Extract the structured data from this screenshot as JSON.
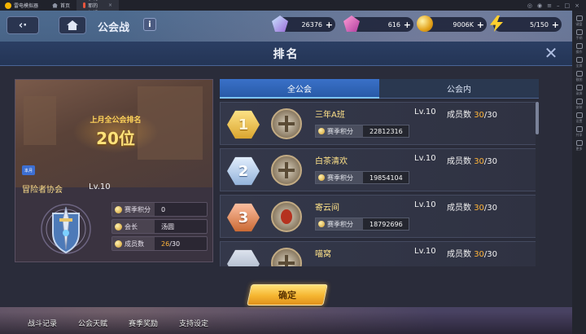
{
  "emulator": {
    "app_name": "雷电模拟器",
    "tabs": [
      {
        "label": "首页"
      },
      {
        "label": "伊利耶的幻想"
      }
    ],
    "side_tools": [
      "键盘",
      "手柄",
      "操作",
      "全屏",
      "截图",
      "录屏",
      "安装",
      "设置",
      "共享",
      "更多"
    ]
  },
  "hud": {
    "title": "公会战",
    "info_label": "i",
    "resources": [
      {
        "icon": "gem-icon",
        "value": "26376"
      },
      {
        "icon": "pink-gem-icon",
        "value": "616"
      },
      {
        "icon": "coin-icon",
        "value": "9006K"
      },
      {
        "icon": "stamina-icon",
        "value": "5/150"
      }
    ]
  },
  "modal": {
    "title": "排名",
    "close_label": "✕"
  },
  "guild": {
    "last_rank_label": "上月全公会排名",
    "last_rank_value": "20位",
    "season_tag": "本月",
    "name": "冒险者协会",
    "level": "Lv.10",
    "stats": [
      {
        "label": "赛季积分",
        "value": "0"
      },
      {
        "label": "会长",
        "value": "汤圆"
      },
      {
        "label": "成员数",
        "value_current": "26",
        "value_total": "/30"
      }
    ]
  },
  "tabs": [
    {
      "label": "全公会",
      "active": true
    },
    {
      "label": "公会内",
      "active": false
    }
  ],
  "ranking": {
    "score_label": "赛季积分",
    "members_label": "成员数",
    "rows": [
      {
        "rank": "1",
        "name": "三年A班",
        "level": "Lv.10",
        "members_current": "30",
        "members_total": "/30",
        "score": "22812316"
      },
      {
        "rank": "2",
        "name": "白茶清欢",
        "level": "Lv.10",
        "members_current": "30",
        "members_total": "/30",
        "score": "19854104"
      },
      {
        "rank": "3",
        "name": "寄云间",
        "level": "Lv.10",
        "members_current": "30",
        "members_total": "/30",
        "score": "18792696"
      },
      {
        "rank": "",
        "name": "喵窝",
        "level": "Lv.10",
        "members_current": "30",
        "members_total": "/30",
        "score": ""
      }
    ]
  },
  "confirm_label": "确定",
  "bottom_nav": [
    "战斗记录",
    "公会天赋",
    "赛季奖励",
    "支持设定"
  ],
  "colors": {
    "accent_blue": "#285aa8",
    "gold": "#ffb43a",
    "confirm": "#f5b530"
  }
}
